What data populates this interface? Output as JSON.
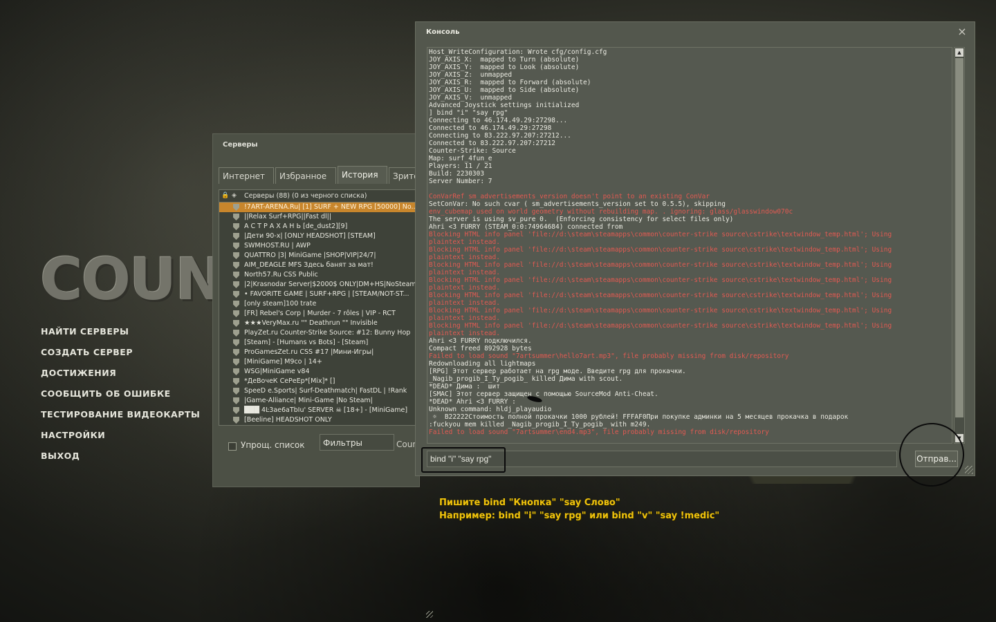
{
  "logo_text": "Counter-Strike",
  "main_menu": [
    "НАЙТИ СЕРВЕРЫ",
    "СОЗДАТЬ СЕРВЕР",
    "ДОСТИЖЕНИЯ",
    "СООБЩИТЬ ОБ ОШИБКЕ",
    "ТЕСТИРОВАНИЕ ВИДЕОКАРТЫ",
    "НАСТРОЙКИ",
    "ВЫХОД"
  ],
  "servers": {
    "title": "Серверы",
    "tabs": [
      "Интернет",
      "Избранное",
      "История",
      "Зрите"
    ],
    "active_tab": "История",
    "header": "Серверы (88) (0 из черного списка)",
    "rows": [
      "!7ART-ARENA.Ru| [1] SURF + NEW RPG [50000] No...",
      "||Relax Surf+RPG||Fast dl||",
      "А С Т Р А Х А Н Ь [de_dust2][9]",
      "|Дети 90-х| [ONLY HEADSHOT] [STEAM]",
      "SWMHOST.RU  |  AWP",
      "QUATTRO |3| MiniGame |SHOP|VIP|24/7|",
      "AIM_DEAGLE MFS Здесь банят за мат!",
      "North57.Ru CSS Public",
      "|2|Krasnodar Server|$2000$ ONLY|DM+HS|NoSteam|",
      "• FAVORITE GAME | SURF+RPG | [STEAM/NOT-ST...",
      "[only steam]100 trate",
      "[FR] Rebel's Corp | Murder - 7 rôles | VIP - RCT",
      "★★★VeryMax.ru \"\" Deathrun \"\" Invisible",
      "PlayZet.ru Counter-Strike Source: #12: Bunny Hop",
      "[Steam] - [Humans vs Bots] - [Steam]",
      "ProGamesZet.ru CSS #17 |Мини-Игры|",
      "[MiniGame] M9co | 14+",
      "WSG|MiniGame v84",
      "*ДеВочеК СеРеЕр*[Mix]* []",
      "SpeeD e.Sports| Surf-Deathmatch| FastDL | !Rank",
      "|Game-Alliance| Mini-Game |No Steam|",
      "███ 4Ŀ3ae6aTbIu' SERVER ☠ [18+] - [MiniGame]",
      "[Beeline] HEADSHOT ONLY"
    ],
    "selected_row": 0,
    "simplified_list_label": "Упрощ. список",
    "filters_label": "Фильтры",
    "count_label": "Count"
  },
  "console": {
    "title": "Консоль",
    "close_glyph": "×",
    "lines": [
      {
        "text": "Host_WriteConfiguration: Wrote cfg/config.cfg",
        "err": false
      },
      {
        "text": "JOY_AXIS_X:  mapped to Turn (absolute)",
        "err": false
      },
      {
        "text": "JOY_AXIS_Y:  mapped to Look (absolute)",
        "err": false
      },
      {
        "text": "JOY_AXIS_Z:  unmapped",
        "err": false
      },
      {
        "text": "JOY_AXIS_R:  mapped to Forward (absolute)",
        "err": false
      },
      {
        "text": "JOY_AXIS_U:  mapped to Side (absolute)",
        "err": false
      },
      {
        "text": "JOY_AXIS_V:  unmapped",
        "err": false
      },
      {
        "text": "Advanced Joystick settings initialized",
        "err": false
      },
      {
        "text": "] bind \"i\" \"say rpg\"",
        "err": false
      },
      {
        "text": "Connecting to 46.174.49.29:27298...",
        "err": false
      },
      {
        "text": "Connected to 46.174.49.29:27298",
        "err": false
      },
      {
        "text": "Connecting to 83.222.97.207:27212...",
        "err": false
      },
      {
        "text": "Connected to 83.222.97.207:27212",
        "err": false
      },
      {
        "text": "Counter-Strike: Source",
        "err": false
      },
      {
        "text": "Map: surf_4fun_e",
        "err": false
      },
      {
        "text": "Players: 11 / 21",
        "err": false
      },
      {
        "text": "Build: 2230303",
        "err": false
      },
      {
        "text": "Server Number: 7",
        "err": false
      },
      {
        "text": "",
        "err": false
      },
      {
        "text": "ConVarRef sm_advertisements_version doesn't point to an existing ConVar",
        "err": true
      },
      {
        "text": "SetConVar: No such cvar ( sm_advertisements_version set to 0.5.5), skipping",
        "err": false
      },
      {
        "text": "env_cubemap used on world geometry without rebuilding map. . ignoring: glass/glasswindow070c",
        "err": true
      },
      {
        "text": "The server is using sv_pure 0.  (Enforcing consistency for select files only)",
        "err": false
      },
      {
        "text": "Ahri <3 FURRY (STEAM_0:0:74964684) connected from",
        "err": false
      },
      {
        "text": "Blocking HTML info panel 'file://d:\\steam\\steamapps\\common\\counter-strike source\\cstrike\\textwindow_temp.html'; Using",
        "err": true
      },
      {
        "text": "plaintext instead.",
        "err": true
      },
      {
        "text": "Blocking HTML info panel 'file://d:\\steam\\steamapps\\common\\counter-strike source\\cstrike\\textwindow_temp.html'; Using",
        "err": true
      },
      {
        "text": "plaintext instead.",
        "err": true
      },
      {
        "text": "Blocking HTML info panel 'file://d:\\steam\\steamapps\\common\\counter-strike source\\cstrike\\textwindow_temp.html'; Using",
        "err": true
      },
      {
        "text": "plaintext instead.",
        "err": true
      },
      {
        "text": "Blocking HTML info panel 'file://d:\\steam\\steamapps\\common\\counter-strike source\\cstrike\\textwindow_temp.html'; Using",
        "err": true
      },
      {
        "text": "plaintext instead.",
        "err": true
      },
      {
        "text": "Blocking HTML info panel 'file://d:\\steam\\steamapps\\common\\counter-strike source\\cstrike\\textwindow_temp.html'; Using",
        "err": true
      },
      {
        "text": "plaintext instead.",
        "err": true
      },
      {
        "text": "Blocking HTML info panel 'file://d:\\steam\\steamapps\\common\\counter-strike source\\cstrike\\textwindow_temp.html'; Using",
        "err": true
      },
      {
        "text": "plaintext instead.",
        "err": true
      },
      {
        "text": "Blocking HTML info panel 'file://d:\\steam\\steamapps\\common\\counter-strike source\\cstrike\\textwindow_temp.html'; Using",
        "err": true
      },
      {
        "text": "plaintext instead.",
        "err": true
      },
      {
        "text": "Ahri <3 FURRY подключился.",
        "err": false
      },
      {
        "text": "Compact freed 892928 bytes",
        "err": false
      },
      {
        "text": "Failed to load sound \"7artsummer\\hello7art.mp3\", file probably missing from disk/repository",
        "err": true
      },
      {
        "text": "Redownloading all lightmaps",
        "err": false
      },
      {
        "text": "[RPG] Этот сервер работает на rpg моде. Введите rpg для прокачки.",
        "err": false
      },
      {
        "text": "_Nagib_progib_I_Ty_pogib_ killed Дима with scout.",
        "err": false
      },
      {
        "text": "*DEAD* Дима :  шит",
        "err": false
      },
      {
        "text": "[SMAC] Этот сервер защищен с помощью SourceMod Anti-Cheat.",
        "err": false
      },
      {
        "text": "*DEAD* Ahri <3 FURRY :",
        "err": false
      },
      {
        "text": "Unknown command: hldj_playaudio",
        "err": false
      },
      {
        "text": " ☼  B22222Стоимость полной прокачки 1000 рублей! FFFAF0При покупке админки на 5 месяцев прокачка в подарок",
        "err": false
      },
      {
        "text": ":fuckyou mem killed _Nagib_progib_I_Ty_pogib_ with m249.",
        "err": false
      },
      {
        "text": "Failed to load sound \"7artsummer\\end4.mp3\", file probably missing from disk/repository",
        "err": true
      }
    ],
    "input_value": "bind \"i\" \"say rpg\"",
    "send_label": "Отправ..."
  },
  "caption": {
    "line1": "Пишите bind \"Кнопка\" \"say Слово\"",
    "line2": "Например: bind \"i\" \"say rpg\" или bind \"v\" \"say !medic\""
  },
  "colors": {
    "selected_row": "#c8862c",
    "error_text": "#e25a52",
    "caption_text": "#f0c30c"
  }
}
